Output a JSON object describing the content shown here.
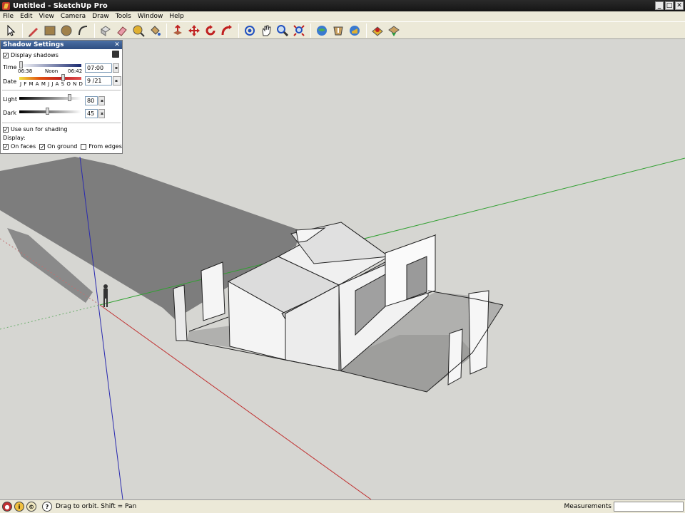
{
  "window": {
    "title": "Untitled - SketchUp Pro",
    "controls": [
      "_",
      "□",
      "✕"
    ]
  },
  "menu": [
    "File",
    "Edit",
    "View",
    "Camera",
    "Draw",
    "Tools",
    "Window",
    "Help"
  ],
  "toolbar": {
    "tools": [
      "select-tool-icon",
      "pencil-line-icon",
      "rectangle-icon",
      "circle-icon",
      "arc-icon",
      "make-component-icon",
      "eraser-icon",
      "tape-measure-icon",
      "paint-bucket-icon",
      "push-pull-icon",
      "move-icon",
      "rotate-icon",
      "follow-me-icon",
      "orbit-icon",
      "pan-icon",
      "zoom-icon",
      "zoom-extents-icon",
      "get-models-icon",
      "share-model-icon",
      "place-model-icon",
      "google-earth-icon",
      "add-location-icon"
    ]
  },
  "shadow_settings": {
    "title": "Shadow Settings",
    "display_shadows": {
      "label": "Display shadows",
      "checked": true
    },
    "time": {
      "label": "Time",
      "value": "07:00",
      "start": "06:38",
      "noon": "Noon",
      "end": "06:42"
    },
    "date": {
      "label": "Date",
      "value": "9 /21",
      "months": "J F M A M J J A S O N D"
    },
    "light": {
      "label": "Light",
      "value": "80"
    },
    "dark": {
      "label": "Dark",
      "value": "45"
    },
    "use_sun": {
      "label": "Use sun for shading",
      "checked": true
    },
    "display_label": "Display:",
    "on_faces": {
      "label": "On faces",
      "checked": true
    },
    "on_ground": {
      "label": "On ground",
      "checked": true
    },
    "from_edges": {
      "label": "From edges",
      "checked": false
    }
  },
  "status": {
    "hint": "Drag to orbit.  Shift = Pan",
    "measurements_label": "Measurements",
    "measurements_value": ""
  },
  "colors": {
    "viewport_bg": "#d6d6d2",
    "red_axis": "#c03030",
    "green_axis": "#30a030",
    "blue_axis": "#3030c0",
    "shadow": "#7a7a7a"
  }
}
